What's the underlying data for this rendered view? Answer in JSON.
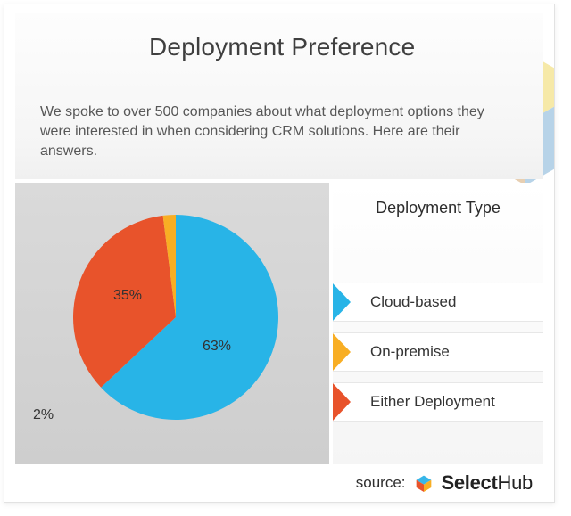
{
  "header": {
    "title": "Deployment Preference",
    "lead": "We spoke to over 500 companies about what deployment options they were interested in when considering CRM solutions. Here are their answers."
  },
  "legend": {
    "title": "Deployment Type",
    "items": [
      {
        "label": "Cloud-based",
        "color": "#28b4e7"
      },
      {
        "label": "On-premise",
        "color": "#f8ae24"
      },
      {
        "label": "Either Deployment",
        "color": "#e8532b"
      }
    ]
  },
  "source": {
    "prefix": "source:",
    "brand_left": "Select",
    "brand_right": "Hub"
  },
  "chart_data": {
    "type": "pie",
    "title": "Deployment Preference",
    "series": [
      {
        "name": "Cloud-based",
        "value": 63,
        "color": "#28b4e7",
        "label": "63%"
      },
      {
        "name": "Either Deployment",
        "value": 35,
        "color": "#e8532b",
        "label": "35%"
      },
      {
        "name": "On-premise",
        "value": 2,
        "color": "#f8ae24",
        "label": "2%"
      }
    ]
  }
}
